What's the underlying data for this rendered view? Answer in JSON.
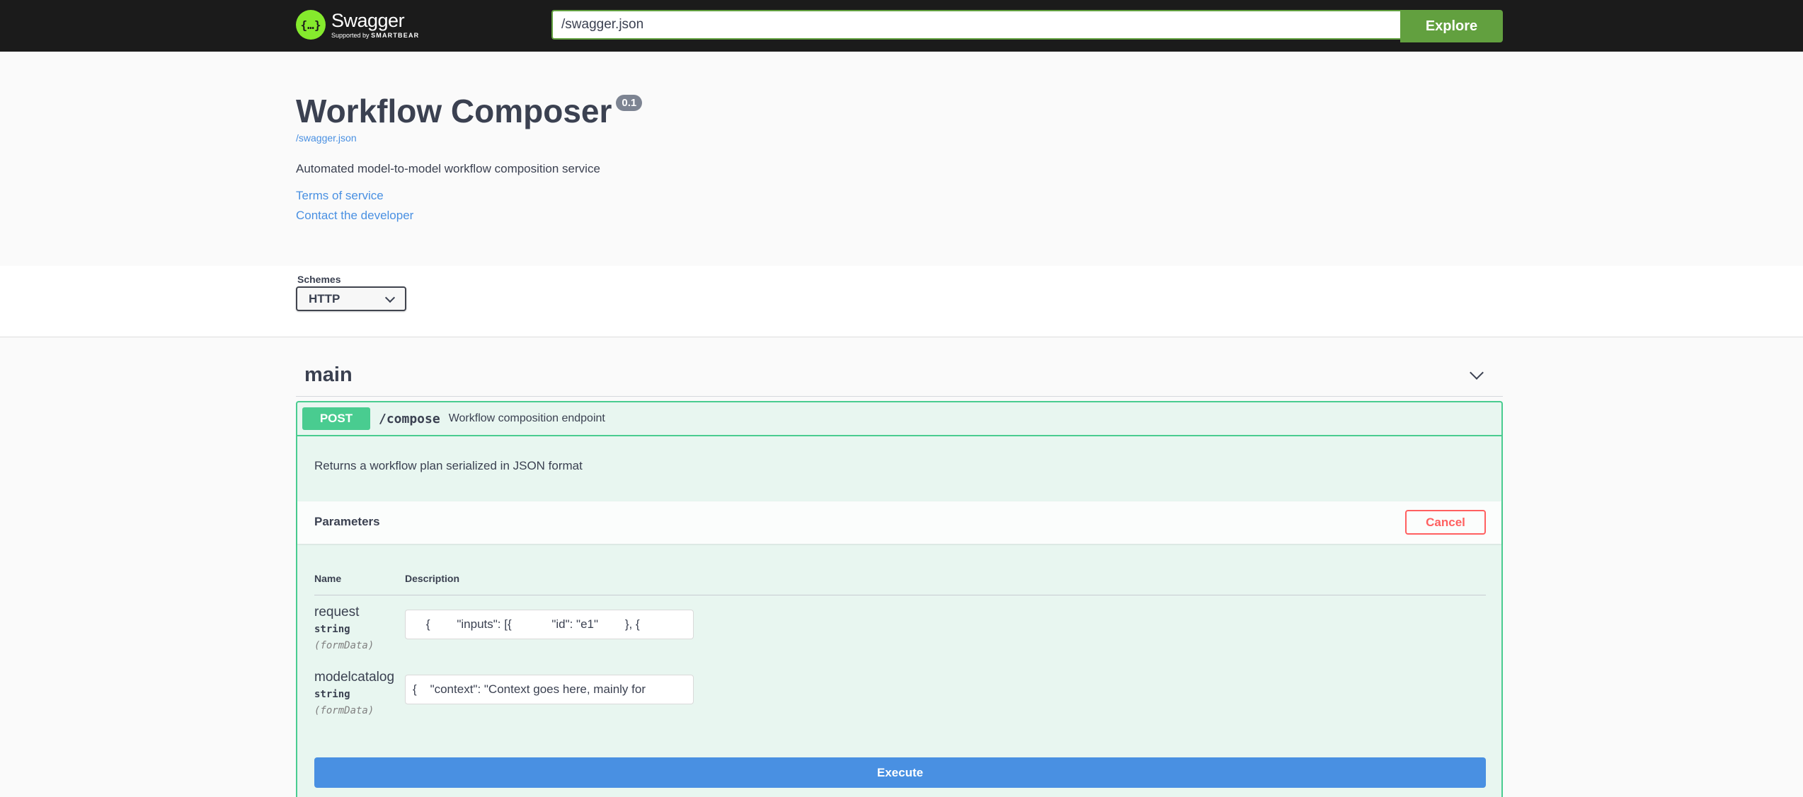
{
  "topbar": {
    "logo_text": "Swagger",
    "logo_sub_prefix": "Supported by",
    "logo_sub_brand": "SMARTBEAR",
    "logo_glyph": "{…}",
    "url_value": "/swagger.json",
    "explore_label": "Explore"
  },
  "info": {
    "title": "Workflow Composer",
    "version": "0.1",
    "spec_link": "/swagger.json",
    "description": "Automated model-to-model workflow composition service",
    "terms_link": "Terms of service",
    "contact_link": "Contact the developer"
  },
  "schemes": {
    "label": "Schemes",
    "selected": "HTTP"
  },
  "tag": {
    "name": "main"
  },
  "operation": {
    "method": "POST",
    "path": "/compose",
    "summary": "Workflow composition endpoint",
    "notes": "Returns a workflow plan serialized in JSON format",
    "parameters_title": "Parameters",
    "cancel_label": "Cancel",
    "col_name": "Name",
    "col_description": "Description",
    "params": [
      {
        "name": "request",
        "type": "string",
        "in": "(formData)",
        "value": "    {        \"inputs\": [{            \"id\": \"e1\"        }, {"
      },
      {
        "name": "modelcatalog",
        "type": "string",
        "in": "(formData)",
        "value": "{    \"context\": \"Context goes here, mainly for"
      }
    ],
    "execute_label": "Execute"
  },
  "colors": {
    "topbar": "#1b1b1b",
    "explore": "#62a03f",
    "post": "#49cc90",
    "execute": "#4990e2",
    "cancel": "#ff6060",
    "link": "#4990e2"
  }
}
